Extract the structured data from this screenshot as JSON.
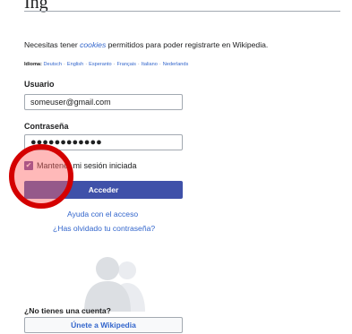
{
  "header": {
    "title_fragment": "Ing"
  },
  "notice": {
    "prefix": "Necesitas tener ",
    "link": "cookies",
    "suffix": " permitidos para poder registrarte en Wikipedia."
  },
  "languages": {
    "label": "Idioma:",
    "items": [
      "Deutsch",
      "English",
      "Esperanto",
      "Français",
      "Italiano",
      "Nederlands"
    ]
  },
  "form": {
    "username_label": "Usuario",
    "username_value": "someuser@gmail.com",
    "password_label": "Contraseña",
    "password_mask": "●●●●●●●●●●●●",
    "remember_label": "Mantener mi sesión iniciada",
    "remember_checked": true,
    "login_button": "Acceder"
  },
  "links": {
    "help": "Ayuda con el acceso",
    "forgot": "¿Has olvidado tu contraseña?"
  },
  "signup": {
    "prompt": "¿No tienes una cuenta?",
    "button": "Únete a Wikipedia"
  },
  "colors": {
    "link": "#3366cc",
    "primary_button": "#3f51a9",
    "checkbox": "#6b4ba1",
    "click_marker": "#d40000"
  },
  "icons": {
    "checkbox_mark": "✔"
  }
}
